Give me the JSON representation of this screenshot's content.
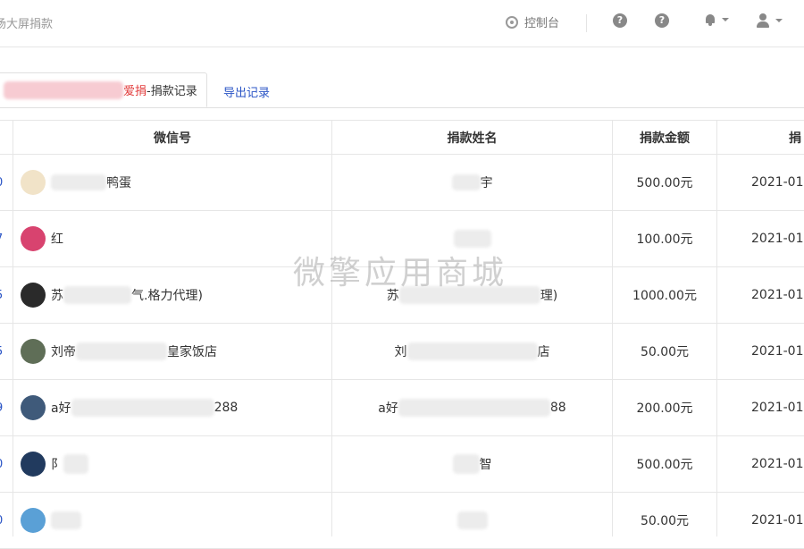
{
  "header": {
    "title": "场大屏捐款",
    "console_label": "控制台"
  },
  "tabs": {
    "active_red": "爱捐",
    "active_suffix": "-捐款记录",
    "export_label": "导出记录"
  },
  "table": {
    "columns": [
      "微信号",
      "捐款姓名",
      "捐款金额",
      "捐"
    ],
    "rows": [
      {
        "left": "0",
        "wx_prefix": "",
        "wx_suffix": "鸭蛋",
        "name_prefix": "",
        "name_suffix": "宇",
        "amount": "500.00元",
        "date": "2021-01",
        "avatar_color": "#f1e3c8"
      },
      {
        "left": "7",
        "wx_prefix": "红",
        "wx_suffix": "",
        "name_prefix": "",
        "name_suffix": "",
        "amount": "100.00元",
        "date": "2021-01",
        "avatar_color": "#d8436f"
      },
      {
        "left": "5",
        "wx_prefix": "苏",
        "wx_suffix": "气.格力代理)",
        "name_prefix": "苏",
        "name_suffix": "理)",
        "amount": "1000.00元",
        "date": "2021-01",
        "avatar_color": "#2a2a2a"
      },
      {
        "left": "5",
        "wx_prefix": "刘帝",
        "wx_suffix": "皇家饭店",
        "name_prefix": "刘",
        "name_suffix": "店",
        "amount": "50.00元",
        "date": "2021-01",
        "avatar_color": "#5f6e57"
      },
      {
        "left": "9",
        "wx_prefix": "a好",
        "wx_suffix": "288",
        "name_prefix": "a好",
        "name_suffix": "88",
        "amount": "200.00元",
        "date": "2021-01",
        "avatar_color": "#3f5a7a"
      },
      {
        "left": "0",
        "wx_prefix": "阝",
        "wx_suffix": "",
        "name_prefix": "",
        "name_suffix": "智",
        "amount": "500.00元",
        "date": "2021-01",
        "avatar_color": "#213a5e"
      },
      {
        "left": "0",
        "wx_prefix": "",
        "wx_suffix": "",
        "name_prefix": "",
        "name_suffix": "",
        "amount": "50.00元",
        "date": "2021-01",
        "avatar_color": "#5aa0d6"
      }
    ]
  },
  "watermark": "微擎应用商城",
  "icons": {
    "console": "console-icon",
    "help": "help-icon",
    "bell": "bell-icon",
    "user": "user-icon"
  }
}
